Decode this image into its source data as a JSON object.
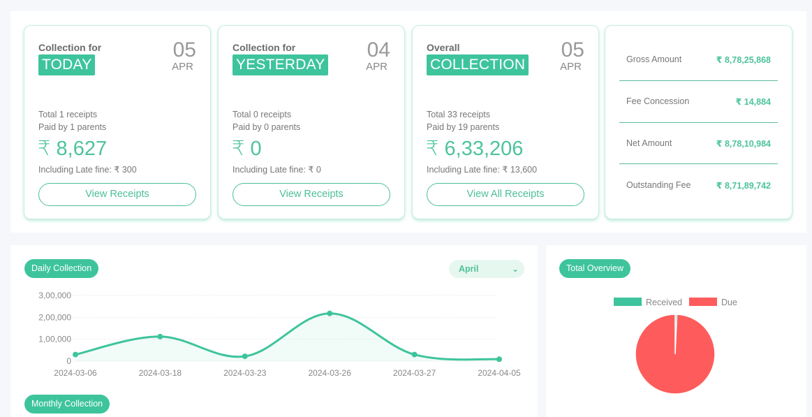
{
  "cards": [
    {
      "subtitle": "Collection for",
      "tag": "TODAY",
      "day": "05",
      "month": "APR",
      "receipts": "Total 1 receipts",
      "parents": "Paid by 1 parents",
      "amount": "₹ 8,627",
      "late_fine": "Including Late fine: ₹ 300",
      "button": "View Receipts"
    },
    {
      "subtitle": "Collection for",
      "tag": "YESTERDAY",
      "day": "04",
      "month": "APR",
      "receipts": "Total 0 receipts",
      "parents": "Paid by 0 parents",
      "amount": "₹ 0",
      "late_fine": "Including Late fine: ₹ 0",
      "button": "View Receipts"
    },
    {
      "subtitle": "Overall",
      "tag": "COLLECTION",
      "day": "05",
      "month": "APR",
      "receipts": "Total 33 receipts",
      "parents": "Paid by 19 parents",
      "amount": "₹ 6,33,206",
      "late_fine": "Including Late fine: ₹ 13,600",
      "button": "View All Receipts"
    }
  ],
  "summary": [
    {
      "label": "Gross Amount",
      "value": "₹ 8,78,25,868"
    },
    {
      "label": "Fee Concession",
      "value": "₹ 14,884"
    },
    {
      "label": "Net Amount",
      "value": "₹ 8,78,10,984"
    },
    {
      "label": "Outstanding Fee",
      "value": "₹ 8,71,89,742"
    }
  ],
  "daily_section": {
    "title": "Daily Collection",
    "month_select": "April",
    "chevron_icon": "chevron-down-icon"
  },
  "monthly_section": {
    "title": "Monthly Collection"
  },
  "overview_section": {
    "title": "Total Overview"
  },
  "colors": {
    "accent": "#3ec49c",
    "line": "#3ec49c",
    "received": "#3ec49c",
    "due": "#fe5c5c"
  },
  "chart_data": [
    {
      "type": "line",
      "title": "Daily Collection",
      "x": [
        "2024-03-06",
        "2024-03-18",
        "2024-03-23",
        "2024-03-26",
        "2024-03-27",
        "2024-04-05"
      ],
      "series": [
        {
          "name": "Collection",
          "values": [
            30000,
            112000,
            22000,
            218000,
            30000,
            8627
          ]
        }
      ],
      "yticks": [
        "0",
        "1,00,000",
        "2,00,000",
        "3,00,000"
      ],
      "ytick_values": [
        0,
        100000,
        200000,
        300000
      ],
      "ylim": [
        0,
        300000
      ],
      "xlabel": "",
      "ylabel": "",
      "grid": true,
      "fill": true
    },
    {
      "type": "pie",
      "title": "Total Overview",
      "categories": [
        "Received",
        "Due"
      ],
      "values": [
        633206,
        87189742
      ],
      "legend": "top"
    }
  ]
}
